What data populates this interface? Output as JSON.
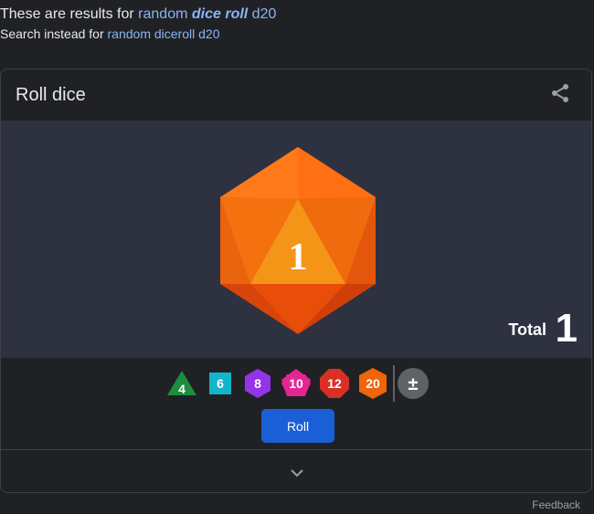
{
  "correction": {
    "prefix": "These are results for ",
    "link_a": "random ",
    "link_b": "dice roll",
    "link_c": " d20",
    "instead_prefix": "Search instead for ",
    "instead_link": "random diceroll d20"
  },
  "card": {
    "title": "Roll dice",
    "share_icon": "share-icon"
  },
  "roll": {
    "die_face": "1",
    "total_label": "Total",
    "total_value": "1",
    "die_color": "#f0640a"
  },
  "dice": [
    {
      "label": "4",
      "color": "#1e8e3e"
    },
    {
      "label": "6",
      "color": "#12b5cb"
    },
    {
      "label": "8",
      "color": "#9334e6"
    },
    {
      "label": "10",
      "color": "#e52592"
    },
    {
      "label": "12",
      "color": "#d93025"
    },
    {
      "label": "20",
      "color": "#f0640a"
    },
    {
      "label": "±",
      "color": "#5f6368"
    }
  ],
  "buttons": {
    "roll": "Roll"
  },
  "footer": {
    "feedback": "Feedback"
  }
}
